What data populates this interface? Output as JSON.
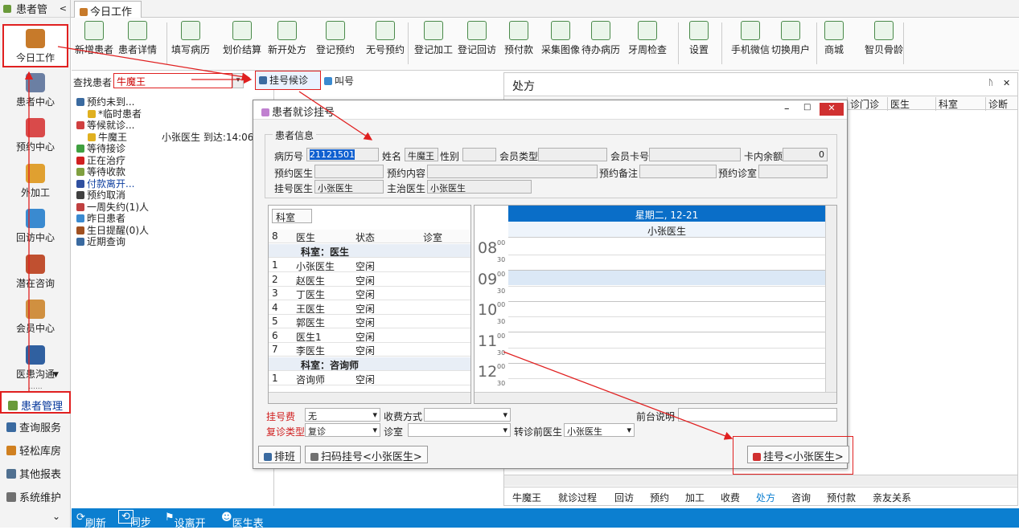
{
  "nav": {
    "header": "患者管",
    "header_chevron": "<",
    "big": [
      {
        "label": "今日工作",
        "color": "#c77a2a"
      },
      {
        "label": "患者中心",
        "color": "#6b7fa3"
      },
      {
        "label": "预约中心",
        "color": "#d94a4a"
      },
      {
        "label": "外加工",
        "color": "#e0a030"
      },
      {
        "label": "回访中心",
        "color": "#3a8ad0"
      },
      {
        "label": "潜在咨询",
        "color": "#c05030"
      },
      {
        "label": "会员中心",
        "color": "#d09040"
      },
      {
        "label": "医患沟通",
        "color": "#3060a0"
      }
    ],
    "more_dots": "......",
    "more_chevron": "▼",
    "menu": [
      {
        "label": "患者管理",
        "color": "#6a9a3a"
      },
      {
        "label": "查询服务",
        "color": "#3a6aa0"
      },
      {
        "label": "轻松库房",
        "color": "#d08020"
      },
      {
        "label": "其他报表",
        "color": "#507090"
      },
      {
        "label": "系统维护",
        "color": "#707070"
      }
    ],
    "bottom_chevron": "⌄"
  },
  "tabs": {
    "today": "今日工作"
  },
  "ribbon": [
    "新增患者",
    "患者详情",
    "填写病历",
    "划价结算",
    "新开处方",
    "登记预约",
    "无号预约",
    "登记加工",
    "登记回访",
    "预付款",
    "采集图像",
    "待办病历",
    "牙周检查",
    "设置",
    "手机微信",
    "切换用户",
    "商城",
    "智贝骨龄"
  ],
  "search": {
    "label": "查找患者",
    "value": "牛魔王",
    "reg_btn": "挂号候诊",
    "call_btn": "叫号"
  },
  "tree": [
    {
      "t": "预约未到...",
      "c": "#3a6aa0",
      "i": 0
    },
    {
      "t": "*临时患者",
      "c": "#e0b020",
      "i": 1
    },
    {
      "t": "等候就诊...",
      "c": "#d04040",
      "i": 0
    },
    {
      "t": "牛魔王",
      "c": "#e0b020",
      "i": 1,
      "extra": "小张医生 到达:14:06"
    },
    {
      "t": "等待接诊",
      "c": "#40a040",
      "i": 0
    },
    {
      "t": "正在治疗",
      "c": "#d02020",
      "i": 0
    },
    {
      "t": "等待收款",
      "c": "#80a040",
      "i": 0
    },
    {
      "t": "付款离开...",
      "c": "#3050a0",
      "i": 0,
      "blue": true
    },
    {
      "t": "预约取消",
      "c": "#404040",
      "i": 0
    },
    {
      "t": "一周失约(1)人",
      "c": "#c04040",
      "i": 0
    },
    {
      "t": "昨日患者",
      "c": "#3a8ad0",
      "i": 0
    },
    {
      "t": "生日提醒(0)人",
      "c": "#a05020",
      "i": 0
    },
    {
      "t": "近期查询",
      "c": "#3a6aa0",
      "i": 0
    }
  ],
  "rpanel": {
    "title": "处方",
    "pin": "ᚢ",
    "close": "✕",
    "cols": [
      "诊门诊",
      "医生",
      "科室",
      "诊断"
    ],
    "bottom_tabs": [
      "牛魔王",
      "就诊过程",
      "回访",
      "预约",
      "加工",
      "收费",
      "处方",
      "咨询",
      "预付款",
      "亲友关系"
    ],
    "active_tab": "处方"
  },
  "bottombar": {
    "refresh": "刷新",
    "sync": "同步",
    "leave": "设离开",
    "doctors": "医生表"
  },
  "dialog": {
    "title": "患者就诊挂号",
    "group": "患者信息",
    "labels": {
      "chart_no": "病历号",
      "name": "姓名",
      "gender": "性别",
      "member_type": "会员类型",
      "card_no": "会员卡号",
      "balance": "卡内余额",
      "appt_doctor": "预约医生",
      "appt_content": "预约内容",
      "appt_note": "预约备注",
      "appt_room": "预约诊室",
      "reg_doctor": "挂号医生",
      "main_doctor": "主治医生"
    },
    "values": {
      "chart_no": "21121501",
      "name": "牛魔王",
      "balance": "0",
      "reg_doctor": "小张医生",
      "main_doctor": "小张医生"
    },
    "grid": {
      "group_header": "科室",
      "count": "8",
      "cols": [
        "医生",
        "状态",
        "诊室"
      ],
      "groups": [
        {
          "name": "科室：医生",
          "rows": [
            [
              "1",
              "小张医生",
              "空闲"
            ],
            [
              "2",
              "赵医生",
              "空闲"
            ],
            [
              "3",
              "丁医生",
              "空闲"
            ],
            [
              "4",
              "王医生",
              "空闲"
            ],
            [
              "5",
              "郭医生",
              "空闲"
            ],
            [
              "6",
              "医生1",
              "空闲"
            ],
            [
              "7",
              "李医生",
              "空闲"
            ]
          ]
        },
        {
          "name": "科室：咨询师",
          "rows": [
            [
              "1",
              "咨询师",
              "空闲"
            ]
          ]
        }
      ]
    },
    "schedule": {
      "date": "星期二, 12-21",
      "doctor": "小张医生",
      "hours": [
        "08",
        "09",
        "10",
        "11",
        "12"
      ],
      "min00": "00",
      "min30": "30"
    },
    "form": {
      "fee_label": "挂号费",
      "fee_value": "无",
      "pay_label": "收费方式",
      "note_label": "前台说明",
      "revisit_label": "复诊类型",
      "revisit_value": "复诊",
      "room_label": "诊室",
      "prev_doctor_label": "转诊前医生",
      "prev_doctor_value": "小张医生"
    },
    "buttons": {
      "schedule": "排班",
      "scan": "扫码挂号<小张医生>",
      "register": "挂号<小张医生>"
    }
  },
  "colors": {
    "accent": "#0c7fd0",
    "red": "#e02020",
    "sched_blue": "#0a6ec8"
  }
}
